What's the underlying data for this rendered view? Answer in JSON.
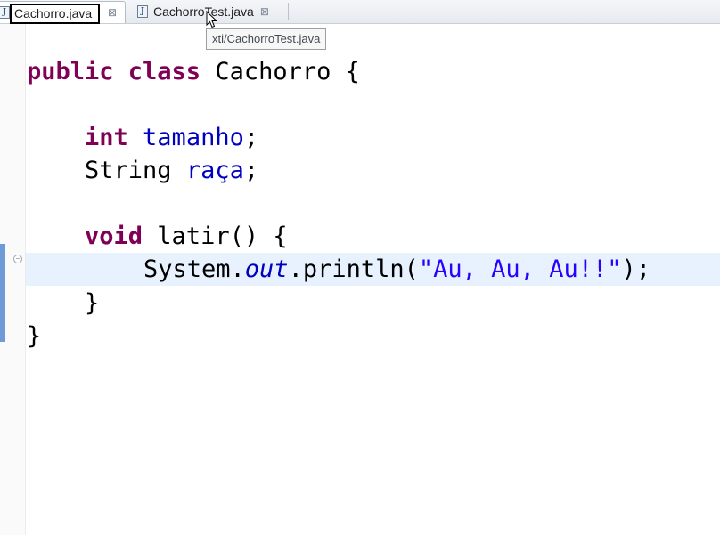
{
  "tabs": [
    {
      "label": "Cachorro.java",
      "active": true,
      "icon": "java-file-icon"
    },
    {
      "label": "CachorroTest.java",
      "active": false,
      "icon": "java-file-icon"
    }
  ],
  "tab_close_glyph": "⊠",
  "tooltip": "xti/CachorroTest.java",
  "code": {
    "class_keywords": "public class",
    "class_name": "Cachorro",
    "open_brace": "{",
    "field1_type": "int",
    "field1_name": "tamanho",
    "semicolon": ";",
    "field2_type": "String",
    "field2_name": "raça",
    "method_type": "void",
    "method_sig": "latir() {",
    "stmt_obj": "System.",
    "stmt_field": "out",
    "stmt_call": ".println(",
    "stmt_string": "\"Au, Au, Au!!\"",
    "stmt_end": ");",
    "close_brace": "}"
  },
  "colors": {
    "keyword": "#7f0055",
    "field": "#0000c0",
    "string": "#2a00ff",
    "current_line": "#e8f2fe"
  }
}
